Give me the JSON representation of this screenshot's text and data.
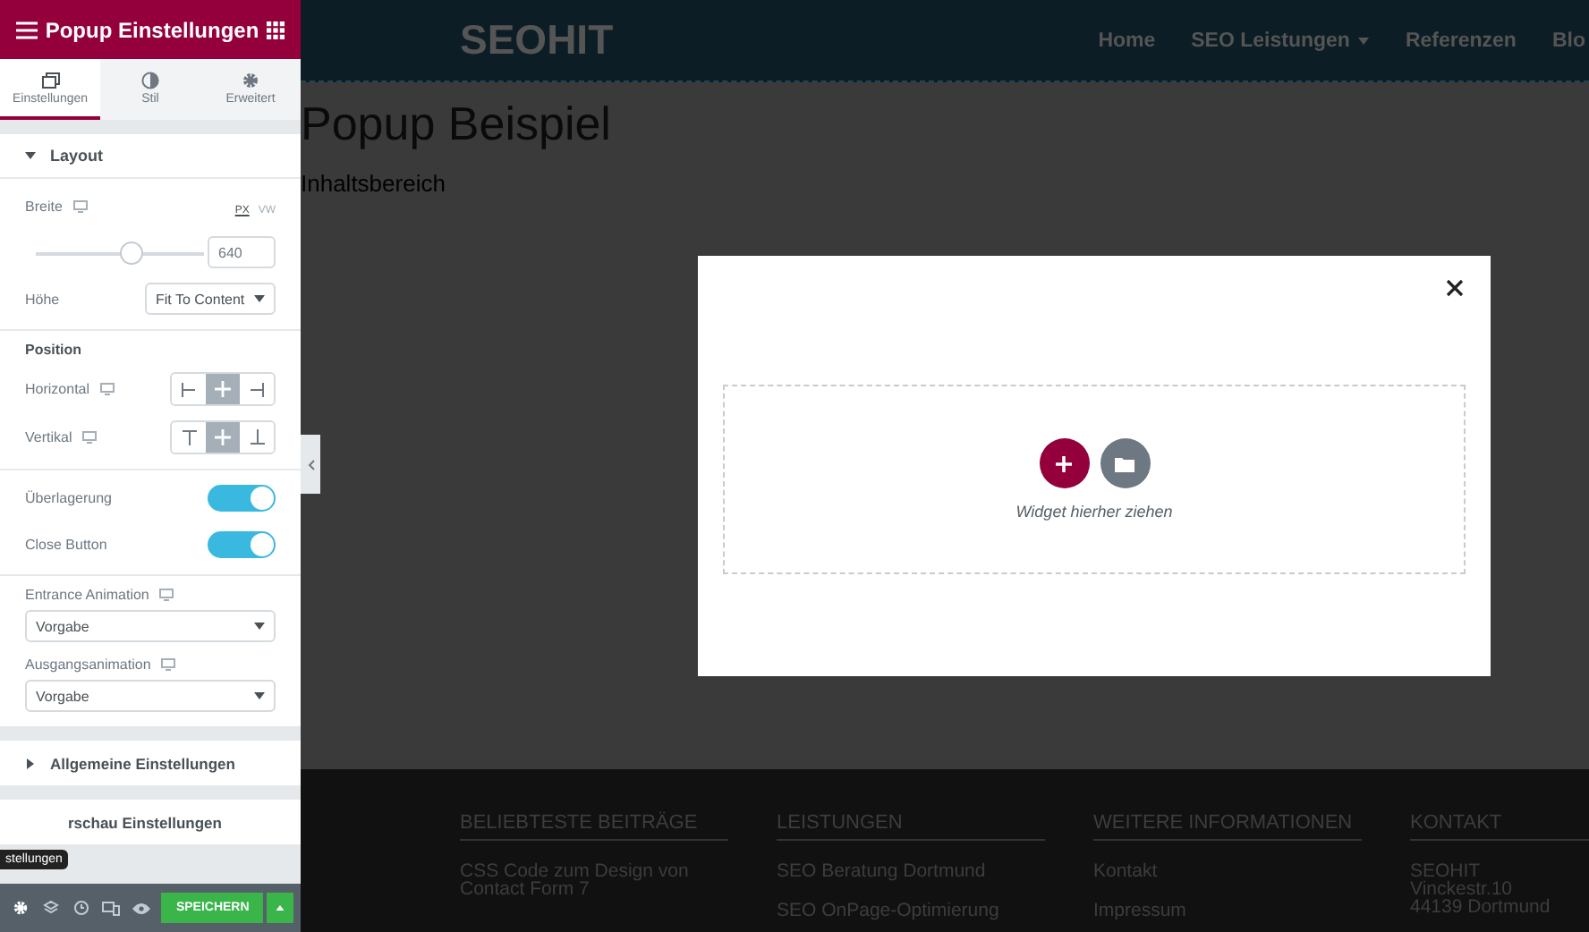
{
  "panel": {
    "title": "Popup Einstellungen",
    "tabs": [
      {
        "label": "Einstellungen",
        "selected": true
      },
      {
        "label": "Stil",
        "selected": false
      },
      {
        "label": "Erweitert",
        "selected": false
      }
    ],
    "layout": {
      "title": "Layout",
      "width": {
        "label": "Breite",
        "units": [
          {
            "label": "PX",
            "selected": true
          },
          {
            "label": "VW",
            "selected": false
          }
        ],
        "level": 0.6,
        "value": "640"
      },
      "height": {
        "label": "Höhe",
        "value": "Fit To Content"
      },
      "position": {
        "title": "Position",
        "rows": [
          {
            "label": "Horizontal",
            "kind": "horizontal",
            "options": [
              {
                "selected": false
              },
              {
                "selected": true
              },
              {
                "selected": false
              }
            ]
          },
          {
            "label": "Vertikal",
            "kind": "vertical",
            "options": [
              {
                "selected": false
              },
              {
                "selected": true
              },
              {
                "selected": false
              }
            ]
          }
        ]
      },
      "toggles": [
        {
          "label": "Überlagerung",
          "on": true
        },
        {
          "label": "Close Button",
          "on": true
        }
      ],
      "selects": [
        {
          "label": "Entrance Animation",
          "value": "Vorgabe"
        },
        {
          "label": "Ausgangsanimation",
          "value": "Vorgabe"
        }
      ]
    },
    "sections": [
      {
        "title": "Allgemeine Einstellungen",
        "expanded": false
      },
      {
        "title": "rschau Einstellungen"
      }
    ],
    "tooltip": "stellungen",
    "save": "SPEICHERN"
  },
  "site": {
    "logo": "SEOHIT",
    "nav": [
      {
        "label": "Home",
        "dropdown": false
      },
      {
        "label": "SEO Leistungen",
        "dropdown": true
      },
      {
        "label": "Referenzen",
        "dropdown": false
      },
      {
        "label": "Blo",
        "dropdown": false
      }
    ],
    "title": "Popup Beispiel",
    "text": "Inhaltsbereich",
    "footer": [
      {
        "heading": "BELIEBTESTE BEITRÄGE",
        "lines": [
          [
            "CSS Code zum Design von",
            "Contact Form 7"
          ]
        ]
      },
      {
        "heading": "LEISTUNGEN",
        "lines": [
          [
            "SEO Beratung Dortmund"
          ],
          [
            "SEO OnPage-Optimierung"
          ]
        ]
      },
      {
        "heading": "WEITERE INFORMATIONEN",
        "lines": [
          [
            "Kontakt"
          ],
          [
            "Impressum"
          ]
        ]
      },
      {
        "heading": "KONTAKT",
        "lines": [
          [
            "SEOHIT",
            "Vinckestr.10",
            "44139 Dortmund"
          ]
        ]
      }
    ]
  },
  "popup": {
    "drop_hint": "Widget hierher ziehen"
  }
}
